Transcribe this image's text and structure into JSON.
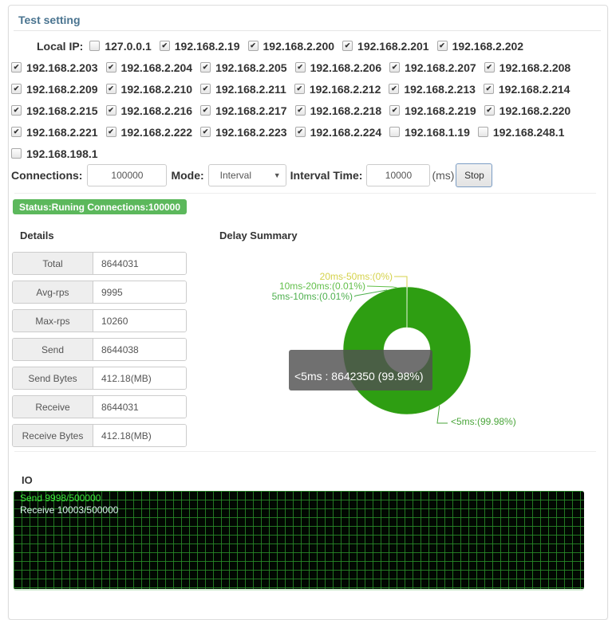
{
  "panel": {
    "title": "Test setting"
  },
  "local_ip": {
    "label": "Local IP:",
    "rows": [
      [
        {
          "ip": "127.0.0.1",
          "checked": false
        },
        {
          "ip": "192.168.2.19",
          "checked": true
        },
        {
          "ip": "192.168.2.200",
          "checked": true
        },
        {
          "ip": "192.168.2.201",
          "checked": true
        },
        {
          "ip": "192.168.2.202",
          "checked": true
        }
      ],
      [
        {
          "ip": "192.168.2.203",
          "checked": true
        },
        {
          "ip": "192.168.2.204",
          "checked": true
        },
        {
          "ip": "192.168.2.205",
          "checked": true
        },
        {
          "ip": "192.168.2.206",
          "checked": true
        },
        {
          "ip": "192.168.2.207",
          "checked": true
        },
        {
          "ip": "192.168.2.208",
          "checked": true
        }
      ],
      [
        {
          "ip": "192.168.2.209",
          "checked": true
        },
        {
          "ip": "192.168.2.210",
          "checked": true
        },
        {
          "ip": "192.168.2.211",
          "checked": true
        },
        {
          "ip": "192.168.2.212",
          "checked": true
        },
        {
          "ip": "192.168.2.213",
          "checked": true
        },
        {
          "ip": "192.168.2.214",
          "checked": true
        }
      ],
      [
        {
          "ip": "192.168.2.215",
          "checked": true
        },
        {
          "ip": "192.168.2.216",
          "checked": true
        },
        {
          "ip": "192.168.2.217",
          "checked": true
        },
        {
          "ip": "192.168.2.218",
          "checked": true
        },
        {
          "ip": "192.168.2.219",
          "checked": true
        },
        {
          "ip": "192.168.2.220",
          "checked": true
        }
      ],
      [
        {
          "ip": "192.168.2.221",
          "checked": true
        },
        {
          "ip": "192.168.2.222",
          "checked": true
        },
        {
          "ip": "192.168.2.223",
          "checked": true
        },
        {
          "ip": "192.168.2.224",
          "checked": true
        },
        {
          "ip": "192.168.1.19",
          "checked": false
        },
        {
          "ip": "192.168.248.1",
          "checked": false
        }
      ],
      [
        {
          "ip": "192.168.198.1",
          "checked": false
        }
      ]
    ]
  },
  "controls": {
    "connections_label": "Connections:",
    "connections_value": "100000",
    "mode_label": "Mode:",
    "mode_value": "Interval",
    "interval_label": "Interval Time:",
    "interval_value": "10000",
    "interval_unit": "(ms)",
    "stop_label": "Stop"
  },
  "status": {
    "text": "Status:Runing Connections:100000",
    "color": "#5cb85c"
  },
  "details": {
    "title": "Details",
    "rows": [
      {
        "label": "Total",
        "value": "8644031"
      },
      {
        "label": "Avg-rps",
        "value": "9995"
      },
      {
        "label": "Max-rps",
        "value": "10260"
      },
      {
        "label": "Send",
        "value": "8644038"
      },
      {
        "label": "Send Bytes",
        "value": "412.18(MB)"
      },
      {
        "label": "Receive",
        "value": "8644031"
      },
      {
        "label": "Receive Bytes",
        "value": "412.18(MB)"
      }
    ]
  },
  "chart_data": {
    "type": "pie",
    "title": "Delay Summary",
    "donut": true,
    "slices": [
      {
        "name": "<5ms",
        "value": 8642350,
        "percent": 99.98,
        "label": "<5ms:(99.98%)",
        "color": "#2e9e12",
        "label_color": "#4aa53a"
      },
      {
        "name": "5ms-10ms",
        "value": null,
        "percent": 0.01,
        "label": "5ms-10ms:(0.01%)",
        "color": "#58b83a",
        "label_color": "#4fb04f"
      },
      {
        "name": "10ms-20ms",
        "value": null,
        "percent": 0.01,
        "label": "10ms-20ms:(0.01%)",
        "color": "#7ccc4a",
        "label_color": "#62bf4a"
      },
      {
        "name": "20ms-50ms",
        "value": null,
        "percent": 0,
        "label": "20ms-50ms:(0%)",
        "color": "#d8e070",
        "label_color": "#d4d24a"
      }
    ],
    "tooltip": "<5ms : 8642350 (99.98%)"
  },
  "io": {
    "title": "IO",
    "send_text": "Send 9998/500000",
    "receive_text": "Receive 10003/500000",
    "send_color": "#39e639",
    "receive_color": "#d7f5ea"
  }
}
